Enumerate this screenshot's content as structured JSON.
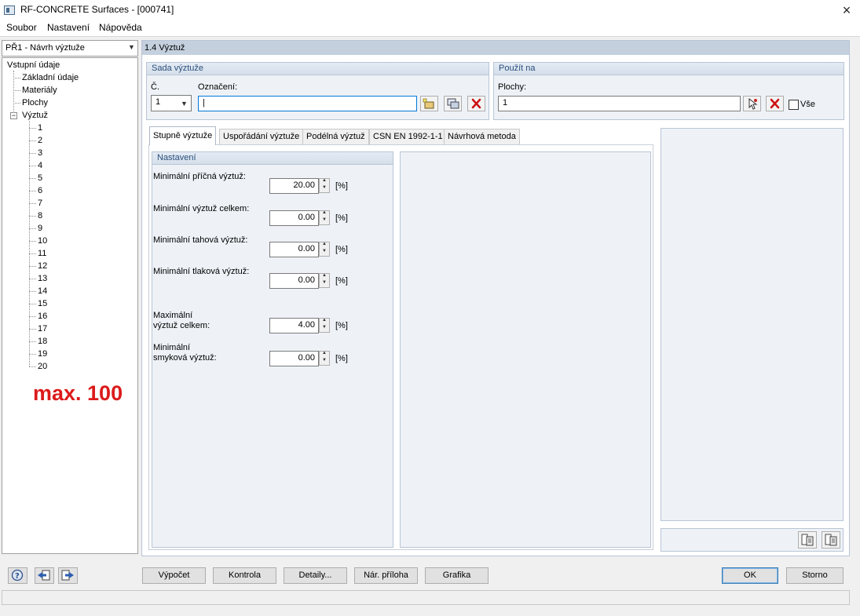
{
  "window": {
    "title": "RF-CONCRETE Surfaces - [000741]",
    "close_icon": "×"
  },
  "menu": [
    "Soubor",
    "Nastavení",
    "Nápověda"
  ],
  "nav": {
    "selected_case": "PŘ1 - Návrh výztuže",
    "tree": {
      "root": "Vstupní údaje",
      "children": [
        "Základní údaje",
        "Materiály",
        "Plochy"
      ],
      "reinforcement": "Výztuž",
      "collapse_glyph": "−",
      "items": [
        "1",
        "2",
        "3",
        "4",
        "5",
        "6",
        "7",
        "8",
        "9",
        "10",
        "11",
        "12",
        "13",
        "14",
        "15",
        "16",
        "17",
        "18",
        "19",
        "20"
      ]
    },
    "annotation": "max. 100"
  },
  "section": {
    "title": "1.4 Výztuž"
  },
  "reinforcement_set": {
    "title": "Sada výztuže",
    "number_label": "Č.",
    "number_value": "1",
    "designation_label": "Označení:",
    "designation_value": "|"
  },
  "apply_to": {
    "title": "Použít na",
    "surfaces_label": "Plochy:",
    "surfaces_value": "1",
    "all_label": "Vše",
    "all_checked": false
  },
  "tabs": [
    "Stupně výztuže",
    "Uspořádání výztuže",
    "Podélná výztuž",
    "CSN EN 1992-1-1",
    "Návrhová metoda"
  ],
  "active_tab": 0,
  "settings": {
    "title": "Nastavení",
    "fields": [
      {
        "label": "Minimální příčná výztuž:",
        "value": "20.00",
        "unit": "[%]"
      },
      {
        "label": "Minimální výztuž celkem:",
        "value": "0.00",
        "unit": "[%]"
      },
      {
        "label": "Minimální tahová výztuž:",
        "value": "0.00",
        "unit": "[%]"
      },
      {
        "label": "Minimální tlaková výztuž:",
        "value": "0.00",
        "unit": "[%]"
      },
      {
        "label_line1": "Maximální",
        "label_line2": "výztuž celkem:",
        "value": "4.00",
        "unit": "[%]"
      },
      {
        "label_line1": "Minimální",
        "label_line2": "smyková výztuž:",
        "value": "0.00",
        "unit": "[%]"
      }
    ]
  },
  "buttons": {
    "calculation": "Výpočet",
    "check": "Kontrola",
    "details": "Detaily...",
    "national_annex": "Nár. příloha",
    "graphics": "Grafika",
    "ok": "OK",
    "cancel": "Storno"
  },
  "colors": {
    "accent": "#2a4f7c",
    "annotation": "#dc1a1a",
    "section_header": "#c4d0de",
    "panel": "#eef2f7"
  }
}
